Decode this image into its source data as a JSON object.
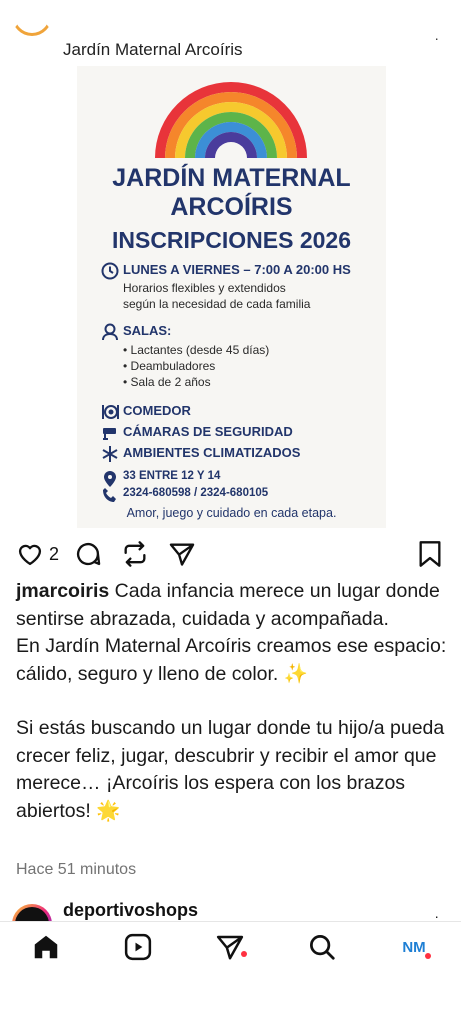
{
  "post": {
    "account": "Jardín Maternal Arcoíris",
    "likes": "2",
    "caption_user": "jmarcoiris",
    "caption_line1": "Cada infancia merece un lugar donde sentirse abrazada, cuidada y acompañada.",
    "caption_line2": "En Jardín Maternal Arcoíris creamos ese espacio: cálido, seguro y lleno de color. ✨",
    "caption_line3": "Si estás buscando un lugar donde tu hijo/a pueda crecer feliz, jugar, descubrir y recibir el amor que merece… ¡Arcoíris los espera con los brazos abiertos! 🌟",
    "time": "Hace 51 minutos"
  },
  "poster": {
    "title1": "JARDÍN MATERNAL",
    "title2": "ARCOÍRIS",
    "title3": "INSCRIPCIONES 2026",
    "schedule": "LUNES A VIERNES – 7:00 A 20:00 HS",
    "schedule_sub1": "Horarios flexibles y extendidos",
    "schedule_sub2": "según la necesidad de cada familia",
    "rooms": "SALAS:",
    "rooms_items": [
      "• Lactantes (desde 45 días)",
      "• Deambuladores",
      "• Sala de 2 años"
    ],
    "feature1": "COMEDOR",
    "feature2": "CÁMARAS DE SEGURIDAD",
    "feature3": "AMBIENTES CLIMATIZADOS",
    "address": "33 ENTRE 12 Y 14",
    "phones": "2324-680598 / 2324-680105",
    "footer": "Amor, juego y cuidado en cada etapa."
  },
  "next_post": {
    "account": "deportivoshops"
  },
  "navbar": {
    "profile_initials": "NM"
  },
  "colors": {
    "poster_blue": "#22356b",
    "notification": "#ff3040"
  },
  "icons": [
    "heart-icon",
    "comment-icon",
    "repost-icon",
    "share-icon",
    "bookmark-icon",
    "home-icon",
    "reels-icon",
    "messages-icon",
    "search-icon"
  ]
}
